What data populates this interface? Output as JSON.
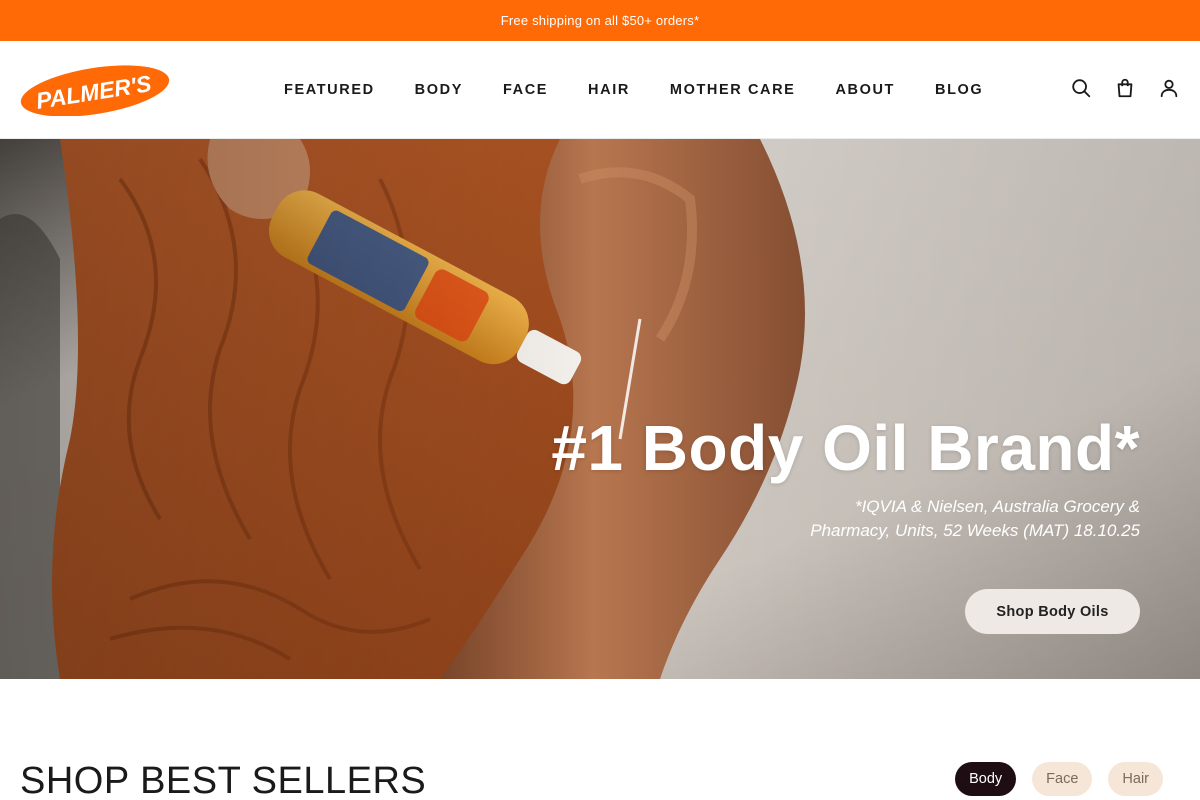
{
  "announcement": {
    "text": "Free shipping on all $50+ orders*"
  },
  "header": {
    "logo_text": "PALMER'S",
    "nav": [
      "FEATURED",
      "BODY",
      "FACE",
      "HAIR",
      "MOTHER CARE",
      "ABOUT",
      "BLOG"
    ],
    "icons": [
      "search-icon",
      "bag-icon",
      "account-icon"
    ]
  },
  "hero": {
    "title": "#1 Body Oil Brand*",
    "note": "*IQVIA & Nielsen, Australia Grocery & Pharmacy, Units, 52 Weeks (MAT) 18.10.25",
    "cta": "Shop Body Oils"
  },
  "best_sellers": {
    "title": "SHOP BEST SELLERS",
    "filters": [
      {
        "label": "Body",
        "active": true
      },
      {
        "label": "Face",
        "active": false
      },
      {
        "label": "Hair",
        "active": false
      }
    ]
  },
  "colors": {
    "brand_orange": "#ff6a06",
    "chip_active": "#1e0e14",
    "chip_inactive": "#f6e6d8",
    "button_bg": "#efe9e6"
  }
}
